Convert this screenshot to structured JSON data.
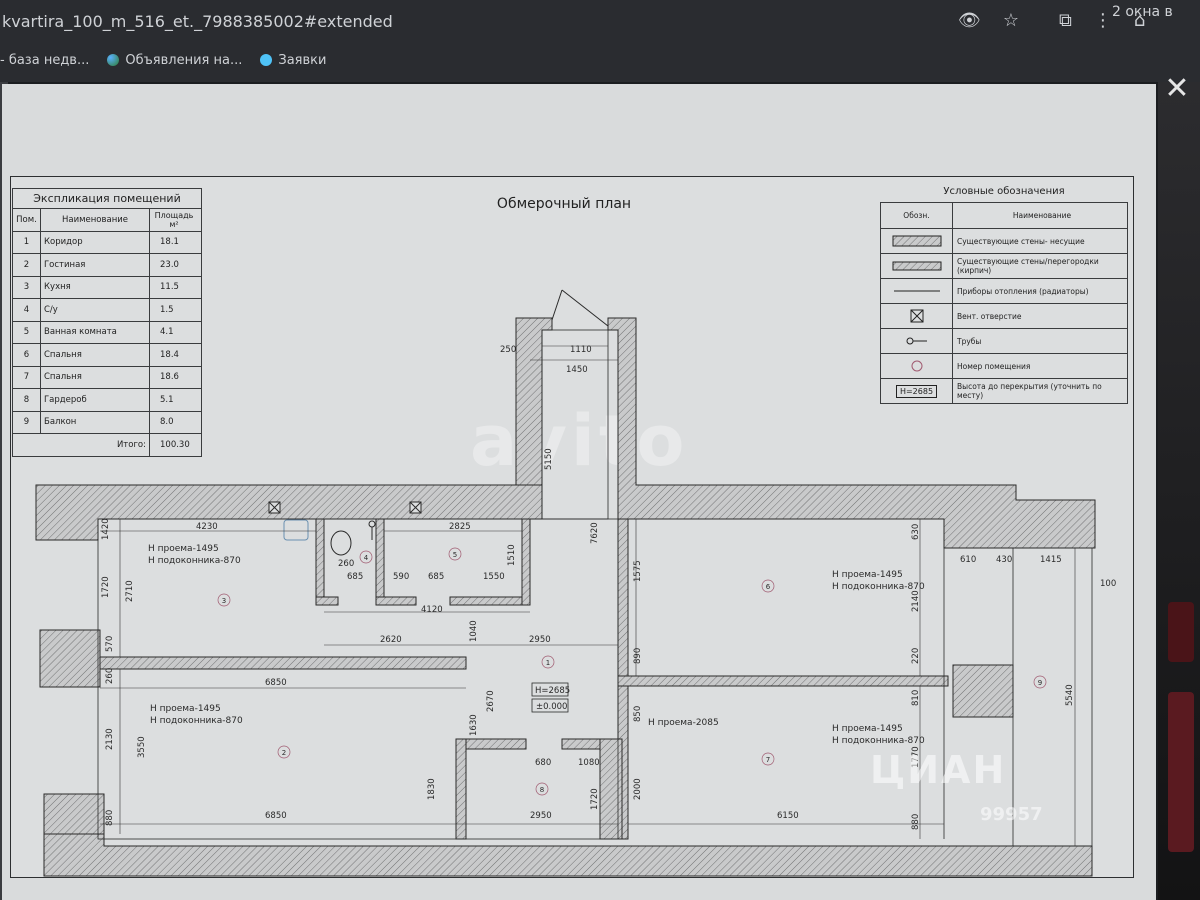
{
  "browser": {
    "url": "kvartira_100_m_516_et._7988385002#extended",
    "windows_label": "2 окна в",
    "bookmarks": [
      "- база недв...",
      "Объявления на...",
      "Заявки"
    ]
  },
  "plan": {
    "title": "Обмерочный план",
    "rooms_table": {
      "caption": "Экспликация помещений",
      "headers": {
        "num": "Пом.",
        "name": "Наименование",
        "area": "Площадь м²"
      },
      "rows": [
        {
          "num": "1",
          "name": "Коридор",
          "area": "18.1"
        },
        {
          "num": "2",
          "name": "Гостиная",
          "area": "23.0"
        },
        {
          "num": "3",
          "name": "Кухня",
          "area": "11.5"
        },
        {
          "num": "4",
          "name": "С/у",
          "area": "1.5"
        },
        {
          "num": "5",
          "name": "Ванная комната",
          "area": "4.1"
        },
        {
          "num": "6",
          "name": "Спальня",
          "area": "18.4"
        },
        {
          "num": "7",
          "name": "Спальня",
          "area": "18.6"
        },
        {
          "num": "8",
          "name": "Гардероб",
          "area": "5.1"
        },
        {
          "num": "9",
          "name": "Балкон",
          "area": "8.0"
        }
      ],
      "total_label": "Итого:",
      "total_value": "100.30"
    },
    "legend": {
      "title": "Условные обозначения",
      "headers": {
        "sym": "Обозн.",
        "desc": "Наименование"
      },
      "items": [
        {
          "icon": "bearing-wall-icon",
          "desc": "Существующие стены- несущие"
        },
        {
          "icon": "partition-icon",
          "desc": "Существующие стены/перегородки (кирпич)"
        },
        {
          "icon": "radiator-icon",
          "desc": "Приборы отопления (радиаторы)"
        },
        {
          "icon": "vent-icon",
          "desc": "Вент. отверстие"
        },
        {
          "icon": "pipe-icon",
          "desc": "Трубы"
        },
        {
          "icon": "room-number-icon",
          "desc": "Номер помещения"
        },
        {
          "icon": "height-mark-icon",
          "sym_text": "Н=2685",
          "desc": "Высота до перекрытия (уточнить по месту)"
        }
      ]
    },
    "annotations": {
      "opening1": "Н проема-1495",
      "sill1": "Н подоконника-870",
      "opening2": "Н проема-1495",
      "sill2": "Н подоконника-870",
      "opening3": "Н проема-1495",
      "sill3": "Н подоконника-870",
      "opening4": "Н проема-1495",
      "sill4": "Н подоконника-870",
      "door_opening": "Н проема-2085",
      "height_box": "Н=2685",
      "level_box": "±0.000"
    },
    "dimensions": {
      "d250": "250",
      "d1110": "1110",
      "d1450": "1450",
      "d5150": "5150",
      "d7620": "7620",
      "d4230": "4230",
      "d2825": "2825",
      "d260": "260",
      "d685a": "685",
      "d590": "590",
      "d685b": "685",
      "d1550": "1550",
      "d1510": "1510",
      "d4120": "4120",
      "d1575": "1575",
      "d2620": "2620",
      "d1040": "1040",
      "d2950a": "2950",
      "d6850a": "6850",
      "d2670": "2670",
      "d1630": "1630",
      "d680": "680",
      "d1080": "1080",
      "d1830": "1830",
      "d1720a": "1720",
      "d2000": "2000",
      "d6850b": "6850",
      "d2950b": "2950",
      "d6150": "6150",
      "d1420": "1420",
      "d1720b": "1720",
      "d2710": "2710",
      "d570": "570",
      "d260b": "260",
      "d2130": "2130",
      "d3550": "3550",
      "d880": "880",
      "d630": "630",
      "d2140": "2140",
      "d220": "220",
      "d810": "810",
      "d1770": "1770",
      "d850": "850",
      "d880b": "880",
      "d890": "890",
      "d860": "860",
      "d610": "610",
      "d430": "430",
      "d1415": "1415",
      "d100": "100",
      "d5540": "5540"
    },
    "room_markers": [
      "1",
      "2",
      "3",
      "4",
      "5",
      "6",
      "7",
      "8",
      "9"
    ]
  },
  "overlays": {
    "watermark_brand": "ЦИАН",
    "watermark_number": "99957",
    "background_brand": "avito"
  }
}
